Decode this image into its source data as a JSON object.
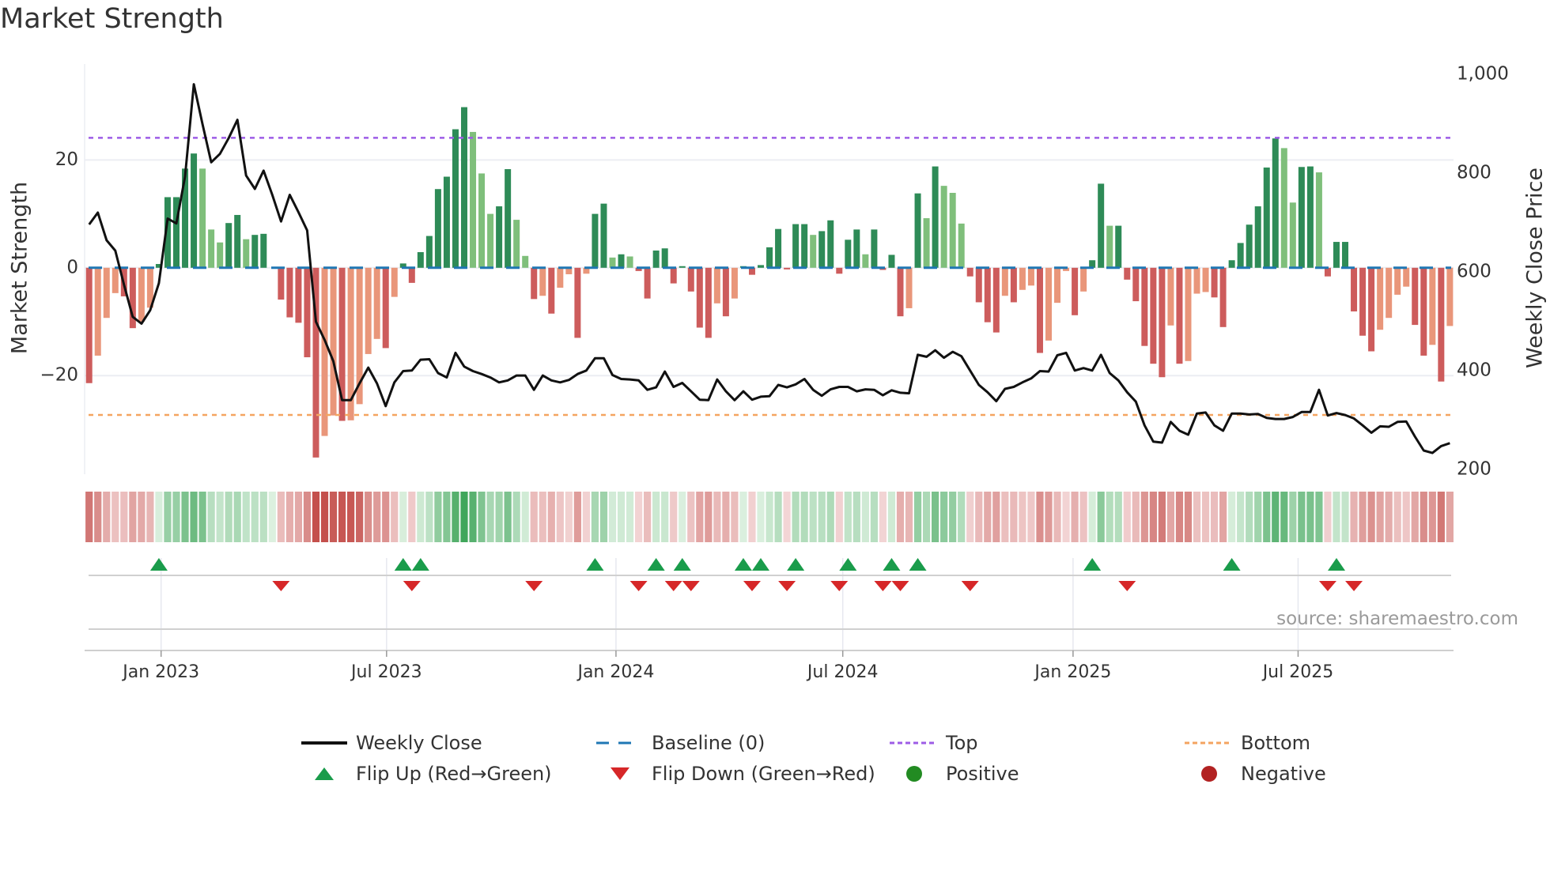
{
  "title": "Market Strength",
  "source": "source: sharemaestro.com",
  "colors": {
    "pos_strong": "#2e8b57",
    "pos_weak": "#7fbf7b",
    "neg_strong": "#cd5c5c",
    "neg_weak": "#e9967a",
    "line": "#111111",
    "baseline": "#1f77b4",
    "top": "#9d5ce6",
    "bottom": "#f4a460",
    "flip_up": "#1a9c4b",
    "flip_down": "#d62728",
    "positive_dot": "#228b22",
    "negative_dot": "#b22222"
  },
  "legend": [
    {
      "key": "weekly_close",
      "label": "Weekly Close"
    },
    {
      "key": "baseline",
      "label": "Baseline (0)"
    },
    {
      "key": "top",
      "label": "Top"
    },
    {
      "key": "bottom",
      "label": "Bottom"
    },
    {
      "key": "flip_up",
      "label": "Flip Up (Red→Green)"
    },
    {
      "key": "flip_down",
      "label": "Flip Down (Green→Red)"
    },
    {
      "key": "positive",
      "label": "Positive"
    },
    {
      "key": "negative",
      "label": "Negative"
    }
  ],
  "chart_data": {
    "type": "bar",
    "title": "Market Strength",
    "ylabel": "Market Strength",
    "y2label": "Weekly Close Price",
    "ylim": [
      -38.3,
      37.8
    ],
    "y2lim": [
      190,
      1021
    ],
    "yticks": [
      {
        "value": 20,
        "label": "20"
      },
      {
        "value": 0,
        "label": "0"
      },
      {
        "value": -20,
        "label": "−20"
      }
    ],
    "y2ticks": [
      {
        "value": 1000,
        "label": "1,000"
      },
      {
        "value": 800,
        "label": "800"
      },
      {
        "value": 600,
        "label": "600"
      },
      {
        "value": 400,
        "label": "400"
      },
      {
        "value": 200,
        "label": "200"
      }
    ],
    "xticks": [
      {
        "week": 8.25,
        "label": "Jan 2023"
      },
      {
        "week": 34.1,
        "label": "Jul 2023"
      },
      {
        "week": 60.4,
        "label": "Jan 2024"
      },
      {
        "week": 86.4,
        "label": "Jul 2024"
      },
      {
        "week": 112.8,
        "label": "Jan 2025"
      },
      {
        "week": 138.6,
        "label": "Jul 2025"
      }
    ],
    "top_level": 24.1,
    "bottom_level": -27.3,
    "baseline": 0,
    "strength": [
      -21.4,
      -16.3,
      -9.3,
      -4.7,
      -5.3,
      -11.2,
      -10,
      -7.4,
      0.7,
      13.1,
      13.1,
      18.4,
      21.2,
      18.4,
      7.1,
      4.7,
      8.3,
      9.8,
      5.3,
      6.1,
      6.3,
      0,
      -5.9,
      -9.2,
      -10.2,
      -16.6,
      -35.2,
      -31.2,
      -27.4,
      -28.4,
      -28.3,
      -25.3,
      -16,
      -13.2,
      -14.9,
      -5.4,
      0.8,
      -2.8,
      2.9,
      5.9,
      14.6,
      16.9,
      25.7,
      29.8,
      25.2,
      17.5,
      10,
      11.4,
      18.3,
      8.9,
      2.2,
      -5.8,
      -5.2,
      -8.5,
      -3.7,
      -1.2,
      -13,
      -1.1,
      10,
      11.9,
      1.9,
      2.5,
      2.1,
      -0.6,
      -5.7,
      3.2,
      3.6,
      -2.9,
      0.3,
      -4.4,
      -11.1,
      -13,
      -6.6,
      -9,
      -5.7,
      0.3,
      -1.3,
      0.5,
      3.8,
      7.2,
      -0.3,
      8.1,
      8.1,
      6.1,
      6.8,
      8.8,
      -1.1,
      5.2,
      7.1,
      2.5,
      7.1,
      -0.4,
      2.4,
      -9,
      -7.5,
      13.8,
      9.2,
      18.8,
      15.2,
      13.9,
      8.2,
      -1.6,
      -6.4,
      -10.1,
      -12,
      -5.2,
      -6.4,
      -4.1,
      -3.3,
      -15.8,
      -13.5,
      -6.5,
      -0.6,
      -8.8,
      -4.4,
      1.4,
      15.6,
      7.8,
      7.8,
      -2.2,
      -6.2,
      -14.5,
      -17.8,
      -20.3,
      -10.7,
      -17.8,
      -17.3,
      -4.8,
      -4.5,
      -5.5,
      -11,
      1.4,
      4.6,
      8,
      11.4,
      18.6,
      24,
      22.2,
      12.1,
      18.7,
      18.8,
      17.7,
      -1.6,
      4.8,
      4.8,
      -8.1,
      -12.6,
      -15.5,
      -11.5,
      -9.3,
      -5,
      -3.5,
      -10.6,
      -16.3,
      -14.3,
      -21.1,
      -10.8
    ],
    "weekly_close": [
      696,
      720,
      664,
      643,
      574,
      509,
      495,
      522,
      577,
      708,
      698,
      793,
      980,
      899,
      822,
      839,
      871,
      908,
      795,
      768,
      805,
      756,
      702,
      756,
      721,
      684,
      499,
      462,
      419,
      340,
      340,
      374,
      406,
      374,
      328,
      376,
      399,
      400,
      422,
      423,
      395,
      386,
      436,
      408,
      399,
      393,
      386,
      376,
      380,
      390,
      390,
      361,
      390,
      380,
      376,
      381,
      393,
      400,
      425,
      425,
      391,
      383,
      382,
      380,
      361,
      366,
      398,
      367,
      375,
      358,
      341,
      340,
      382,
      358,
      340,
      358,
      341,
      347,
      348,
      371,
      366,
      372,
      383,
      361,
      349,
      362,
      367,
      367,
      358,
      362,
      361,
      350,
      360,
      355,
      354,
      432,
      428,
      441,
      426,
      438,
      429,
      400,
      371,
      356,
      338,
      363,
      367,
      376,
      384,
      399,
      398,
      431,
      436,
      400,
      405,
      400,
      432,
      395,
      380,
      356,
      337,
      289,
      256,
      254,
      296,
      278,
      270,
      313,
      315,
      289,
      278,
      313,
      313,
      311,
      312,
      304,
      302,
      302,
      306,
      316,
      316,
      361,
      309,
      314,
      310,
      303,
      289,
      274,
      287,
      286,
      296,
      297,
      266,
      238,
      233,
      247,
      253
    ]
  }
}
